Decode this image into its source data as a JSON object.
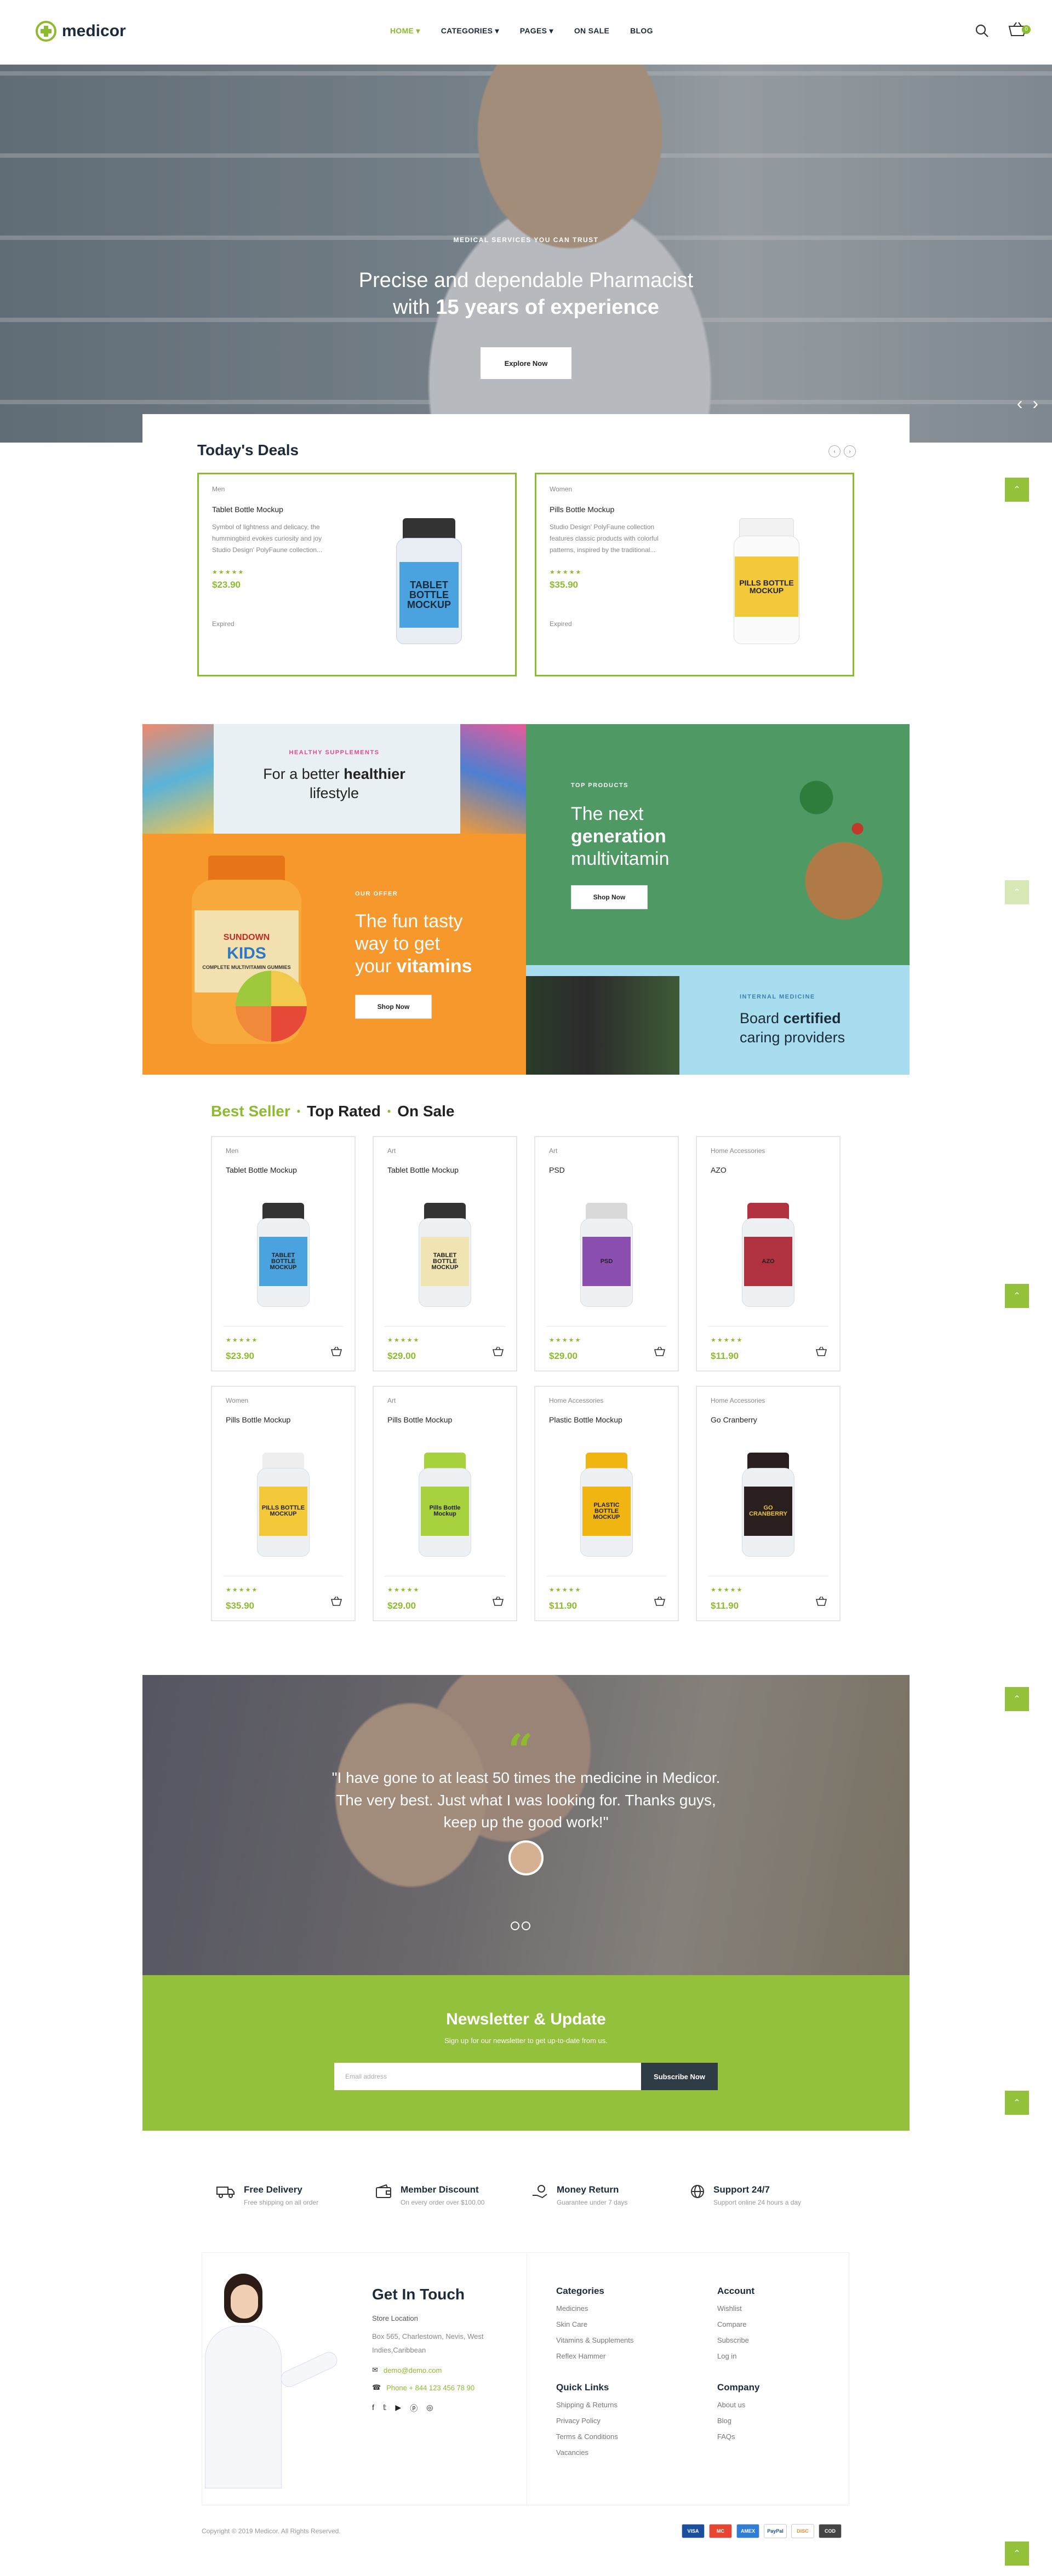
{
  "brand": {
    "name": "medicor"
  },
  "nav": [
    {
      "label": "HOME",
      "active": true,
      "dropdown": true
    },
    {
      "label": "CATEGORIES",
      "dropdown": true
    },
    {
      "label": "PAGES",
      "dropdown": true
    },
    {
      "label": "ON SALE"
    },
    {
      "label": "BLOG"
    }
  ],
  "header": {
    "cart_count": "0"
  },
  "hero": {
    "kicker": "MEDICAL SERVICES YOU CAN TRUST",
    "title_line1": "Precise and dependable Pharmacist",
    "title_pre": "with ",
    "title_bold": "15 years of experience",
    "button": "Explore Now"
  },
  "deals": {
    "title": "Today's Deals",
    "items": [
      {
        "category": "Men",
        "name": "Tablet Bottle Mockup",
        "desc1": "Symbol of lightness and delicacy, the",
        "desc2": "hummingbird evokes curiosity and joy",
        "desc3": "Studio Design' PolyFaune collection...",
        "stars": "★★★★★",
        "price": "$23.90",
        "status": "Expired",
        "label": "TABLET BOTTLE MOCKUP"
      },
      {
        "category": "Women",
        "name": "Pills Bottle Mockup",
        "desc1": "Studio Design' PolyFaune collection",
        "desc2": "features classic products with colorful",
        "desc3": "patterns, inspired by the traditional...",
        "stars": "★★★★★",
        "price": "$35.90",
        "status": "Expired",
        "label": "PILLS BOTTLE MOCKUP"
      }
    ]
  },
  "banners": {
    "b1": {
      "kicker": "HEALTHY SUPPLEMENTS",
      "line1": "For a better ",
      "bold": "healthier",
      "line2": "lifestyle"
    },
    "b2": {
      "kicker": "TOP PRODUCTS",
      "line1": "The next",
      "bold": "generation",
      "line2": "multivitamin",
      "button": "Shop Now"
    },
    "b3": {
      "kicker": "OUR OFFER",
      "line1": "The fun tasty",
      "line2": "way to get",
      "line3_pre": "your ",
      "bold": "vitamins",
      "button": "Shop Now",
      "jar_brand": "SUNDOWN",
      "jar_kids": "KIDS",
      "jar_sub": "COMPLETE MULTIVITAMIN GUMMIES"
    },
    "b4": {
      "kicker": "INTERNAL MEDICINE",
      "line1_pre": "Board ",
      "bold": "certified",
      "line2": "caring providers"
    }
  },
  "products": {
    "tabs": [
      "Best Seller",
      "Top Rated",
      "On Sale"
    ],
    "items": [
      {
        "category": "Men",
        "name": "Tablet Bottle Mockup",
        "stars": "★★★★★",
        "price": "$23.90",
        "label": "TABLET BOTTLE MOCKUP",
        "color": "#4aa3df",
        "cap": "#333"
      },
      {
        "category": "Art",
        "name": "Tablet Bottle Mockup",
        "stars": "★★★★★",
        "price": "$29.00",
        "label": "TABLET BOTTLE MOCKUP",
        "color": "#f1e4b3",
        "cap": "#333"
      },
      {
        "category": "Art",
        "name": "PSD",
        "stars": "★★★★★",
        "price": "$29.00",
        "label": "PSD",
        "color": "#8b4fb0",
        "cap": "#d9d9d9"
      },
      {
        "category": "Home Accessories",
        "name": "AZO",
        "stars": "★★★★★",
        "price": "$11.90",
        "label": "AZO",
        "color": "#b0313f",
        "cap": "#b0313f"
      },
      {
        "category": "Women",
        "name": "Pills Bottle Mockup",
        "stars": "★★★★★",
        "price": "$35.90",
        "label": "PILLS BOTTLE MOCKUP",
        "color": "#f3c93a",
        "cap": "#eee"
      },
      {
        "category": "Art",
        "name": "Pills Bottle Mockup",
        "stars": "★★★★★",
        "price": "$29.00",
        "label": "Pills Bottle Mockup",
        "color": "#a7d13d",
        "cap": "#a7d13d"
      },
      {
        "category": "Home Accessories",
        "name": "Plastic Bottle Mockup",
        "stars": "★★★★★",
        "price": "$11.90",
        "label": "PLASTIC BOTTLE MOCKUP",
        "color": "#f0b511",
        "cap": "#f0b511"
      },
      {
        "category": "Home Accessories",
        "name": "Go Cranberry",
        "stars": "★★★★★",
        "price": "$11.90",
        "label": "GO CRANBERRY",
        "color": "#2a1f1f",
        "cap": "#2a1f1f"
      }
    ]
  },
  "testimonial": {
    "quote1": "\"I have gone to at least 50 times the medicine in Medicor.",
    "quote2": "The very best. Just what I was looking for. Thanks guys,",
    "quote3": "keep up the good work!\""
  },
  "newsletter": {
    "title": "Newsletter & Update",
    "subtitle": "Sign up for our newsletter to get up-to-date from us.",
    "placeholder": "Email address",
    "button": "Subscribe Now"
  },
  "features": [
    {
      "title": "Free Delivery",
      "sub": "Free shipping on all order",
      "icon": "truck-icon"
    },
    {
      "title": "Member Discount",
      "sub": "On every order over $100.00",
      "icon": "wallet-icon"
    },
    {
      "title": "Money Return",
      "sub": "Guarantee under 7 days",
      "icon": "hand-money-icon"
    },
    {
      "title": "Support 24/7",
      "sub": "Support online 24 hours a day",
      "icon": "globe-icon"
    }
  ],
  "footer": {
    "contact_title": "Get In Touch",
    "store_label": "Store Location",
    "address1": "Box 565, Charlestown, Nevis, West",
    "address2": "Indies,Caribbean",
    "email": "demo@demo.com",
    "phone": "Phone + 844 123 456 78 90",
    "categories_title": "Categories",
    "categories": [
      "Medicines",
      "Skin Care",
      "Vitamins & Supplements",
      "Reflex Hammer"
    ],
    "account_title": "Account",
    "account": [
      "Wishlist",
      "Compare",
      "Subscribe",
      "Log in"
    ],
    "quick_title": "Quick Links",
    "quick": [
      "Shipping & Returns",
      "Privacy Policy",
      "Terms & Conditions",
      "Vacancies"
    ],
    "company_title": "Company",
    "company": [
      "About us",
      "Blog",
      "FAQs"
    ],
    "copyright": "Copyright © 2019 Medicor. All Rights Reserved.",
    "payments": [
      "VISA",
      "MC",
      "AMEX",
      "PayPal",
      "DISC",
      "COD"
    ]
  }
}
